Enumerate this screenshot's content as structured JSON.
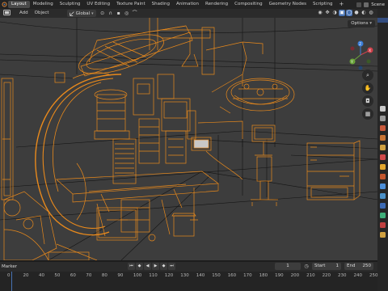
{
  "topbar": {
    "tabs": [
      "Layout",
      "Modeling",
      "Sculpting",
      "UV Editing",
      "Texture Paint",
      "Shading",
      "Animation",
      "Rendering",
      "Compositing",
      "Geometry Nodes",
      "Scripting"
    ],
    "active_tab": "Layout",
    "add_workspace": "+",
    "scene_name": "Scene"
  },
  "viewport_header": {
    "menu_add": "Add",
    "menu_object": "Object",
    "orientation": "Global",
    "options_label": "Options"
  },
  "gizmo": {
    "x_label": "X",
    "y_label": "Y",
    "z_label": "Z"
  },
  "timeline": {
    "marker_label": "Marker",
    "current_frame": "1",
    "start_label": "Start",
    "start_value": "1",
    "end_label": "End",
    "end_value": "250",
    "ticks": [
      "0",
      "20",
      "40",
      "50",
      "60",
      "70",
      "80",
      "90",
      "100",
      "110",
      "120",
      "130",
      "140",
      "150",
      "160",
      "170",
      "180",
      "190",
      "200",
      "210",
      "220",
      "230",
      "240",
      "250"
    ]
  },
  "colors": {
    "wire_selected": "#e8891c",
    "wire_unselected": "#101010",
    "viewport_bg": "#3d3d3d",
    "accent": "#4772b3",
    "gizmo_x": "#d0404a",
    "gizmo_y": "#6aa53a",
    "gizmo_z": "#3a7ed8"
  },
  "icons": [
    "hand-icon",
    "zoom-icon",
    "camera-icon",
    "grid-icon",
    "magnet-icon",
    "proportional-icon",
    "play-icon",
    "jump-start-icon",
    "jump-end-icon",
    "keyframe-icon"
  ]
}
